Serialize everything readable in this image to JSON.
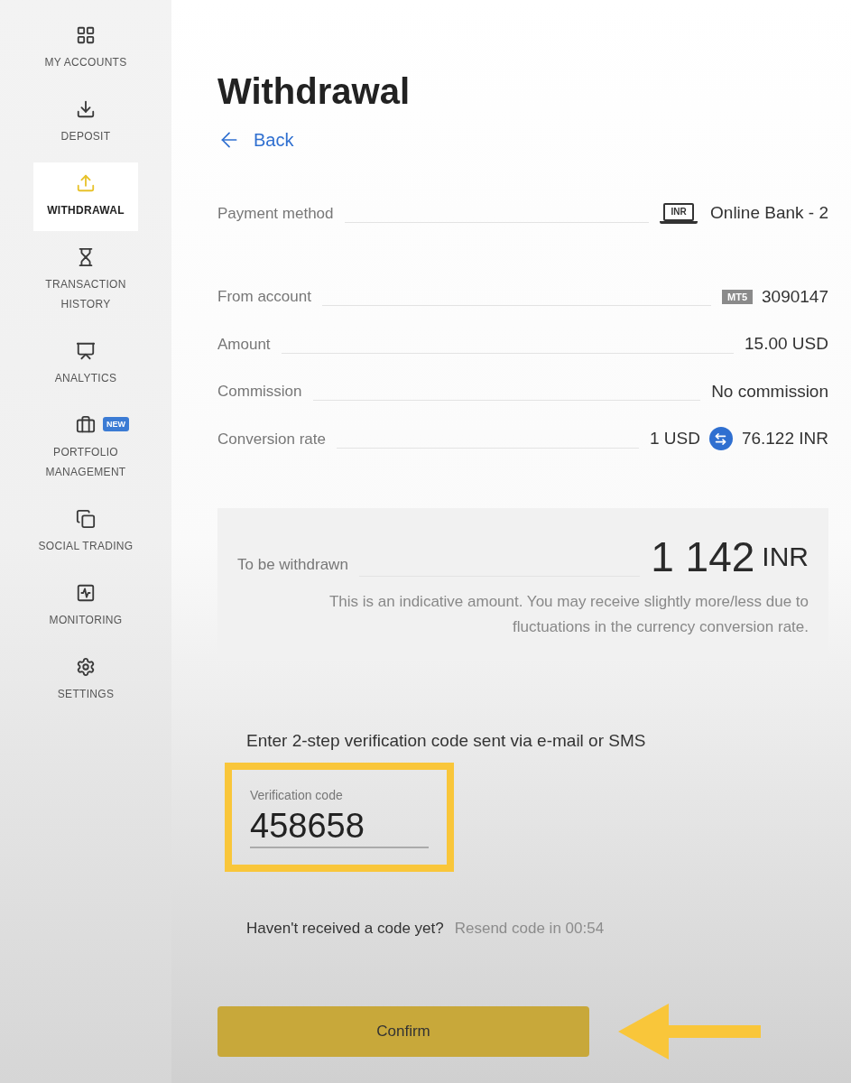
{
  "sidebar": {
    "items": [
      {
        "label": "MY ACCOUNTS",
        "selected": false
      },
      {
        "label": "DEPOSIT",
        "selected": false
      },
      {
        "label": "WITHDRAWAL",
        "selected": true
      },
      {
        "label": "TRANSACTION HISTORY",
        "selected": false
      },
      {
        "label": "ANALYTICS",
        "selected": false
      },
      {
        "label": "PORTFOLIO MANAGEMENT",
        "selected": false,
        "badge": "NEW"
      },
      {
        "label": "SOCIAL TRADING",
        "selected": false
      },
      {
        "label": "MONITORING",
        "selected": false
      },
      {
        "label": "SETTINGS",
        "selected": false
      }
    ]
  },
  "page": {
    "title": "Withdrawal",
    "back_link": "Back"
  },
  "details": [
    {
      "label": "Payment method",
      "kind": "method",
      "icon_text": "INR",
      "value": "Online Bank - 2"
    },
    {
      "label": "From account",
      "kind": "account",
      "tag": "MT5",
      "value": "3090147"
    },
    {
      "label": "Amount",
      "kind": "plain",
      "value": "15.00 USD"
    },
    {
      "label": "Commission",
      "kind": "plain",
      "value": "No commission"
    },
    {
      "label": "Conversion rate",
      "kind": "rate",
      "from": "1 USD",
      "to": "76.122 INR"
    }
  ],
  "summary": {
    "label": "To be withdrawn",
    "amount": "1 142",
    "currency": "INR",
    "note": "This is an indicative amount. You may receive slightly more/less due to fluctuations in the currency conversion rate."
  },
  "verification": {
    "instruction": "Enter 2-step verification code sent via e-mail or SMS",
    "field_label": "Verification code",
    "value": "458658",
    "highlighted": true,
    "question": "Haven't received a code yet?",
    "resend": "Resend code in 00:54"
  },
  "confirm_button": "Confirm"
}
